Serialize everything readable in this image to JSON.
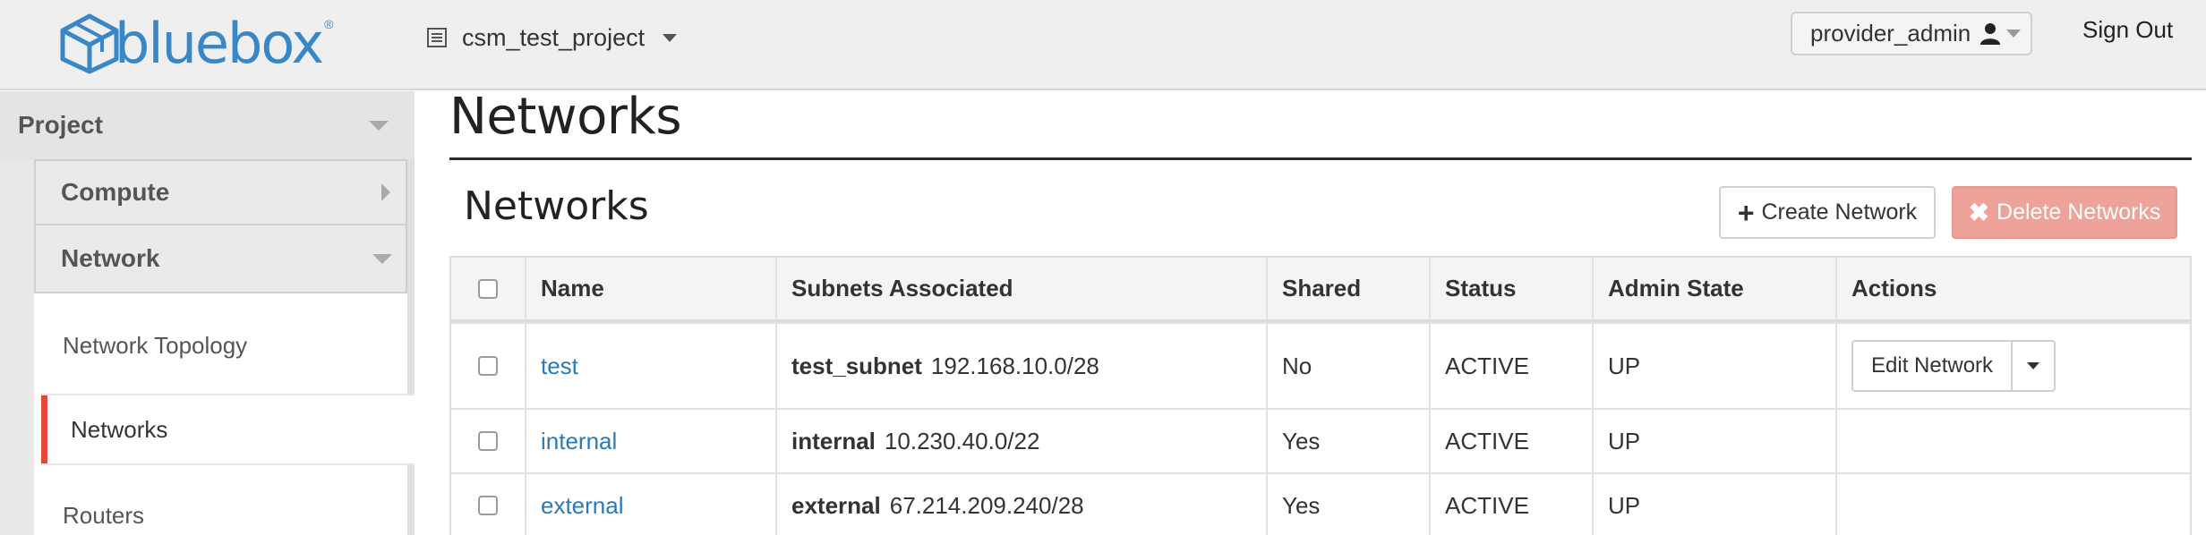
{
  "app": {
    "logo_text": "bluebox",
    "logo_reg": "®",
    "project_switcher": "csm_test_project",
    "user_menu": "provider_admin",
    "sign_out": "Sign Out"
  },
  "sidebar": {
    "project": "Project",
    "compute": "Compute",
    "network": "Network",
    "items": [
      {
        "label": "Network Topology",
        "active": false
      },
      {
        "label": "Networks",
        "active": true
      },
      {
        "label": "Routers",
        "active": false
      }
    ]
  },
  "main": {
    "page_title": "Networks",
    "section_title": "Networks",
    "create_button": "Create Network",
    "delete_button": "Delete Networks"
  },
  "table": {
    "columns": [
      "Name",
      "Subnets Associated",
      "Shared",
      "Status",
      "Admin State",
      "Actions"
    ],
    "rows": [
      {
        "name": "test",
        "subnet_name": "test_subnet",
        "subnet_cidr": "192.168.10.0/28",
        "shared": "No",
        "status": "ACTIVE",
        "admin_state": "UP",
        "action": "Edit Network"
      },
      {
        "name": "internal",
        "subnet_name": "internal",
        "subnet_cidr": "10.230.40.0/22",
        "shared": "Yes",
        "status": "ACTIVE",
        "admin_state": "UP",
        "action": ""
      },
      {
        "name": "external",
        "subnet_name": "external",
        "subnet_cidr": "67.214.209.240/28",
        "shared": "Yes",
        "status": "ACTIVE",
        "admin_state": "UP",
        "action": ""
      }
    ]
  },
  "colors": {
    "brand": "#3a87c8",
    "link": "#2a7ab9",
    "active_accent": "#e04a3c",
    "danger_button": "#eea29a"
  },
  "icons": {
    "project_switcher": "list-icon",
    "user": "user-icon",
    "create": "plus-icon",
    "delete": "x-icon"
  }
}
